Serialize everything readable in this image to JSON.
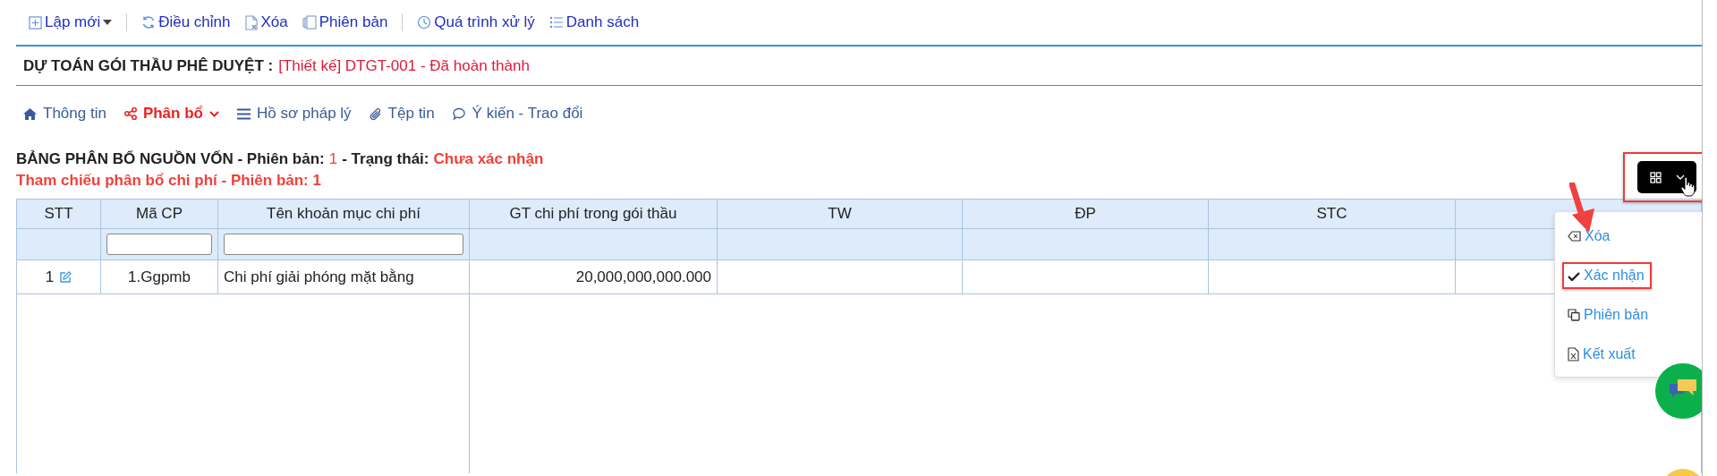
{
  "toolbar_groups": [
    [
      {
        "label": "Lập mới",
        "has_caret": true
      }
    ],
    [
      {
        "label": "Điều chỉnh",
        "has_caret": false
      },
      {
        "label": "Xóa",
        "has_caret": false
      },
      {
        "label": "Phiên bản",
        "has_caret": false
      }
    ],
    [
      {
        "label": "Quá trình xử lý",
        "has_caret": false
      },
      {
        "label": "Danh sách",
        "has_caret": false
      }
    ]
  ],
  "record": {
    "title": "DỰ TOÁN GÓI THẦU PHÊ DUYỆT :",
    "status": "[Thiết kế] DTGT-001 - Đã hoàn thành"
  },
  "tabs": [
    {
      "label": "Thông tin",
      "selected": false
    },
    {
      "label": "Phân bổ",
      "selected": true
    },
    {
      "label": "Hồ sơ pháp lý",
      "selected": false
    },
    {
      "label": "Tệp tin",
      "selected": false
    },
    {
      "label": "Ý kiến - Trao đổi",
      "selected": false
    }
  ],
  "section": {
    "title": "BẢNG PHÂN BỔ NGUỒN VỐN - Phiên bản:",
    "version": "1",
    "state_label": "- Trạng thái:",
    "state": "Chưa xác nhận",
    "reference": "Tham chiếu phân bổ chi phí - Phiên bản: 1"
  },
  "table": {
    "columns": [
      {
        "label": "STT",
        "filter": false
      },
      {
        "label": "Mã CP",
        "filter": true
      },
      {
        "label": "Tên khoản mục chi phí",
        "filter": true
      },
      {
        "label": "GT chi phí trong gói thầu",
        "filter": false
      },
      {
        "label": "TW",
        "filter": false
      },
      {
        "label": "ĐP",
        "filter": false
      },
      {
        "label": "STC",
        "filter": false
      }
    ],
    "rows": [
      {
        "stt": "1",
        "code": "1.Ggpmb",
        "name": "Chi phí giải phóng mặt bằng",
        "value": "20,000,000,000.000"
      }
    ]
  },
  "action_menu": [
    {
      "label": "Xóa",
      "selected": false
    },
    {
      "label": "Xác nhận",
      "selected": true
    },
    {
      "label": "Phiên bản",
      "selected": false
    },
    {
      "label": "Kết xuất",
      "selected": false
    }
  ]
}
